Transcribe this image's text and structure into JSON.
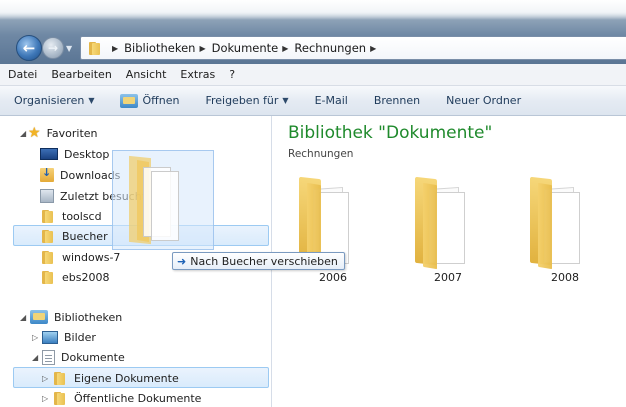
{
  "address": {
    "breadcrumbs": [
      "Bibliotheken",
      "Dokumente",
      "Rechnungen"
    ]
  },
  "menu": [
    "Datei",
    "Bearbeiten",
    "Ansicht",
    "Extras",
    "?"
  ],
  "commands": {
    "organize": "Organisieren",
    "open": "Öffnen",
    "share": "Freigeben für",
    "email": "E-Mail",
    "burn": "Brennen",
    "new_folder": "Neuer Ordner"
  },
  "nav": {
    "favorites": {
      "label": "Favoriten",
      "items": [
        "Desktop",
        "Downloads",
        "Zuletzt besucht",
        "toolscd",
        "Buecher",
        "windows-7",
        "ebs2008"
      ]
    },
    "libraries": {
      "label": "Bibliotheken",
      "items": [
        "Bilder",
        "Dokumente",
        "Eigene Dokumente",
        "Öffentliche Dokumente"
      ]
    }
  },
  "content": {
    "title": "Bibliothek \"Dokumente\"",
    "subtitle": "Rechnungen",
    "folders": [
      "2006",
      "2007",
      "2008"
    ]
  },
  "drag": {
    "tooltip": "Nach Buecher verschieben"
  },
  "colors": {
    "library_title": "#1f8a2c",
    "selection_bg": "#d9ebfc",
    "selection_border": "#9ccaf2"
  }
}
